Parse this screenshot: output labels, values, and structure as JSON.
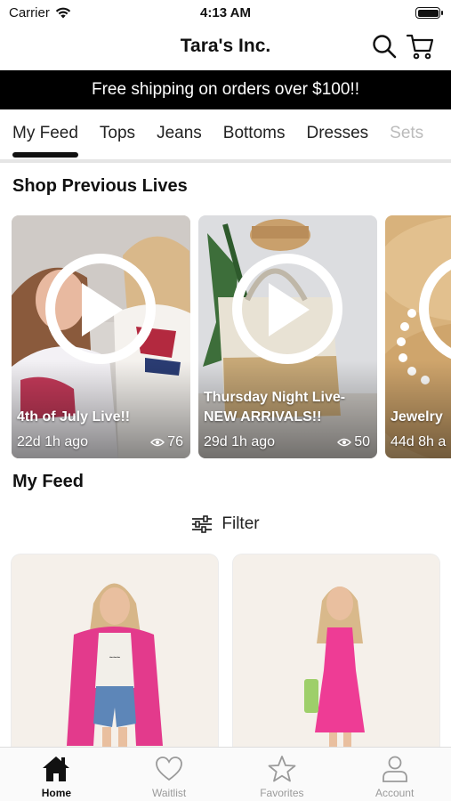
{
  "status_bar": {
    "carrier": "Carrier",
    "time": "4:13 AM"
  },
  "nav": {
    "title": "Tara's Inc."
  },
  "promo": {
    "text": "Free shipping on orders over $100!!"
  },
  "tabs": [
    "My Feed",
    "Tops",
    "Jeans",
    "Bottoms",
    "Dresses",
    "Sets"
  ],
  "sections": {
    "previous_lives": "Shop Previous Lives",
    "my_feed": "My Feed"
  },
  "lives": [
    {
      "title": "4th of July Live!!",
      "age": "22d 1h ago",
      "views": "76"
    },
    {
      "title": "Thursday Night Live- NEW ARRIVALS!!",
      "age": "29d 1h ago",
      "views": "50"
    },
    {
      "title": "Jewelry",
      "age": "44d 8h a"
    }
  ],
  "filter": {
    "label": "Filter"
  },
  "tab_bar": [
    {
      "label": "Home",
      "icon": "home-icon",
      "active": true
    },
    {
      "label": "Waitlist",
      "icon": "heart-icon",
      "active": false
    },
    {
      "label": "Favorites",
      "icon": "star-icon",
      "active": false
    },
    {
      "label": "Account",
      "icon": "person-icon",
      "active": false
    }
  ],
  "colors": {
    "banner_bg": "#000000",
    "banner_text": "#ffffff",
    "product_pink": "#e33a8c",
    "tab_inactive": "#9a9a9a"
  }
}
